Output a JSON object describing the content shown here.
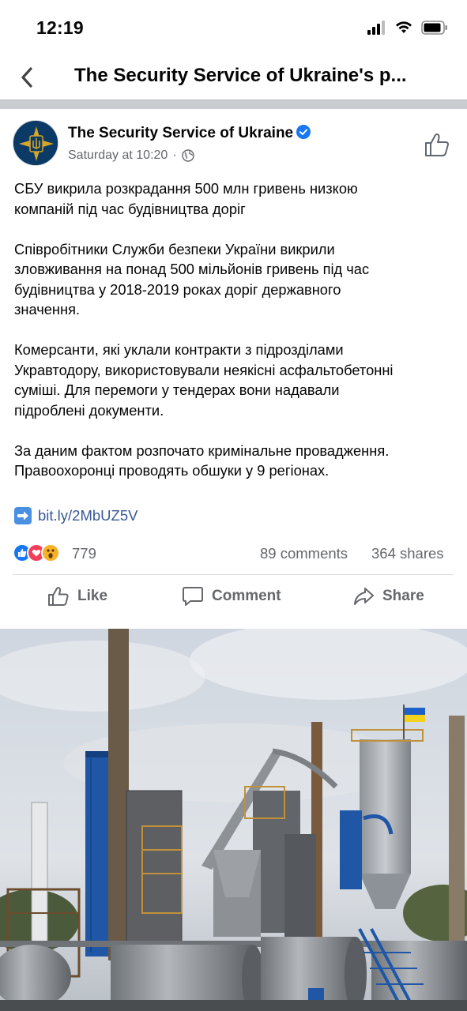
{
  "status_bar": {
    "time": "12:19",
    "icons": [
      "signal-icon",
      "wifi-icon",
      "battery-icon"
    ]
  },
  "nav": {
    "back_icon": "chevron-left-icon",
    "title": "The Security Service of Ukraine's p..."
  },
  "post": {
    "page_name": "The Security Service of Ukraine",
    "verified": true,
    "timestamp": "Saturday at 10:20",
    "separator": "·",
    "audience_icon": "globe-icon",
    "paragraphs": [
      [
        "СБУ викрила розкрадання 500 млн гривень низкою",
        "компаній під час будівництва доріг"
      ],
      [
        "Співробітники Служби безпеки України викрили",
        "зловживання на понад 500 мільйонів гривень під час",
        "будівництва у 2018-2019 роках доріг державного",
        "значення."
      ],
      [
        "Комерсанти, які уклали контракти з підрозділами",
        "Укравтодору, використовували неякісні асфальтобетонні",
        "суміші. Для перемоги у тендерах вони надавали",
        "підроблені документи."
      ],
      [
        "За даним фактом розпочато кримінальне провадження.",
        "Правоохоронці проводять обшуки у 9 регіонах."
      ]
    ],
    "link_icon": "right-arrow-emoji-icon",
    "link": "bit.ly/2MbUZ5V",
    "reactions": {
      "icons": [
        "like-reaction-icon",
        "love-reaction-icon",
        "wow-reaction-icon"
      ],
      "count": "779",
      "comments": "89 comments",
      "shares": "364 shares"
    },
    "actions": {
      "like": "Like",
      "comment": "Comment",
      "share": "Share"
    }
  },
  "colors": {
    "brand_blue": "#1877f2",
    "link_blue": "#385898",
    "muted_text": "#65676b",
    "divider": "#c9ccd1"
  }
}
